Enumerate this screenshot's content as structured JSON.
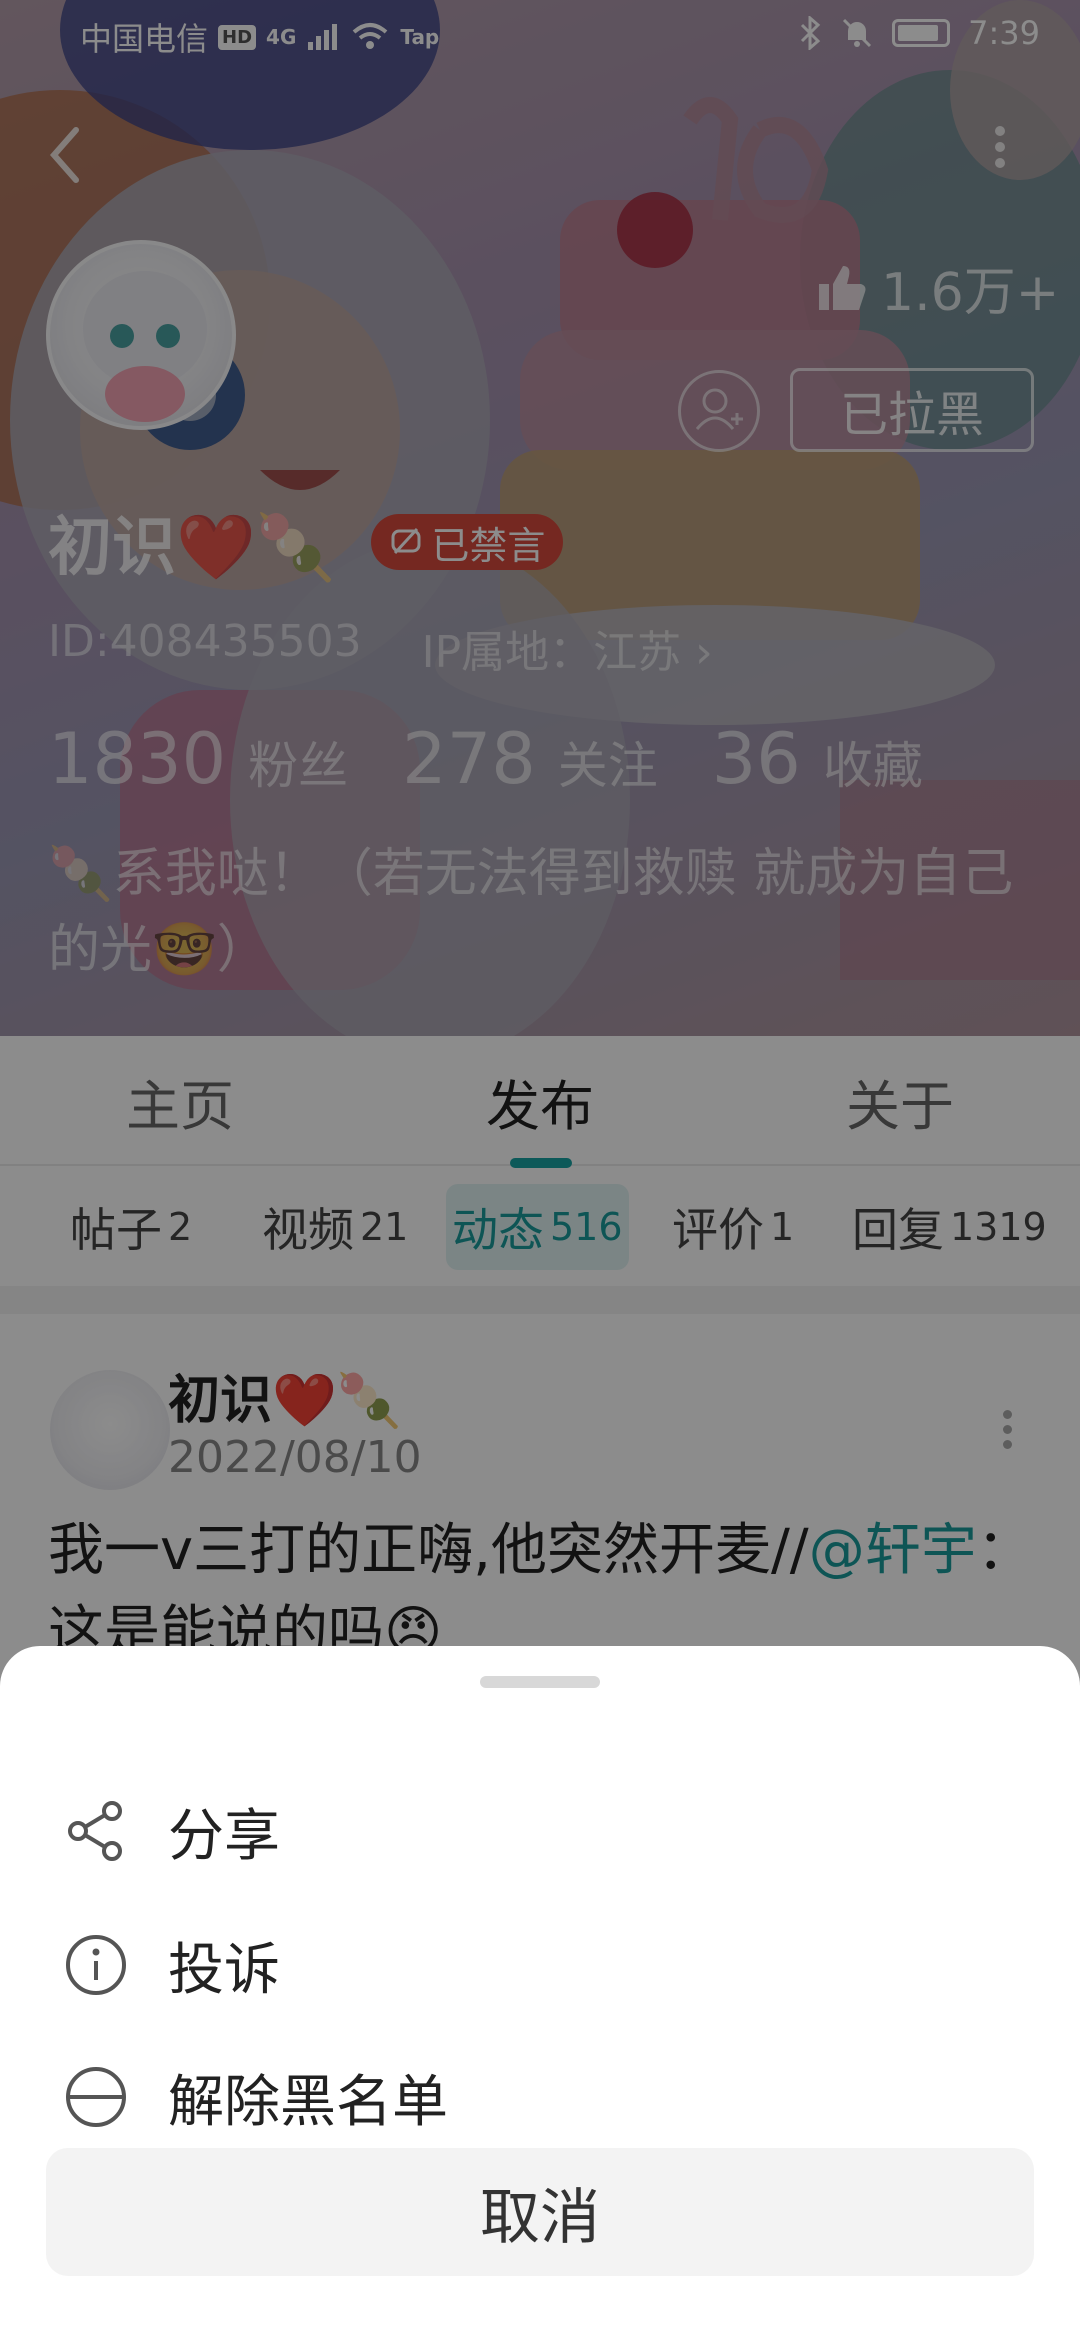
{
  "status_bar": {
    "carrier": "中国电信",
    "hd": "HD",
    "network": "4G",
    "tap": "Tap",
    "time": "7:39"
  },
  "profile": {
    "nickname": "初识❤️🍡",
    "muted_badge": "已禁言",
    "id": "ID:408435503",
    "ip_location": "IP属地：江苏 ›",
    "likes": "1.6万+",
    "blocked_button": "已拉黑",
    "stats": [
      {
        "value": "1830",
        "label": "粉丝"
      },
      {
        "value": "278",
        "label": "关注"
      },
      {
        "value": "36",
        "label": "收藏"
      }
    ],
    "bio": "🍡系我哒！（若无法得到救赎 就成为自己的光🤓）"
  },
  "tabs": [
    {
      "label": "主页"
    },
    {
      "label": "发布"
    },
    {
      "label": "关于"
    }
  ],
  "active_tab": "发布",
  "subtabs": [
    {
      "label": "帖子",
      "count": "2"
    },
    {
      "label": "视频",
      "count": "21"
    },
    {
      "label": "动态",
      "count": "516"
    },
    {
      "label": "评价",
      "count": "1"
    },
    {
      "label": "回复",
      "count": "1319"
    }
  ],
  "active_subtab": "动态",
  "post": {
    "author": "初识❤️🍡",
    "date": "2022/08/10",
    "text": "我一v三打的正嗨,他突然开麦//",
    "mention": "@轩宇",
    "text_rest": "：这是能说的吗😠"
  },
  "sheet": {
    "items": [
      {
        "label": "分享",
        "icon": "share-icon"
      },
      {
        "label": "投诉",
        "icon": "info-icon"
      },
      {
        "label": "解除黑名单",
        "icon": "unblock-icon"
      }
    ],
    "cancel": "取消"
  },
  "colors": {
    "accent": "#18a3a3",
    "muted_badge": "#d64a3d",
    "overlay": "rgba(0,0,0,0.45)"
  }
}
